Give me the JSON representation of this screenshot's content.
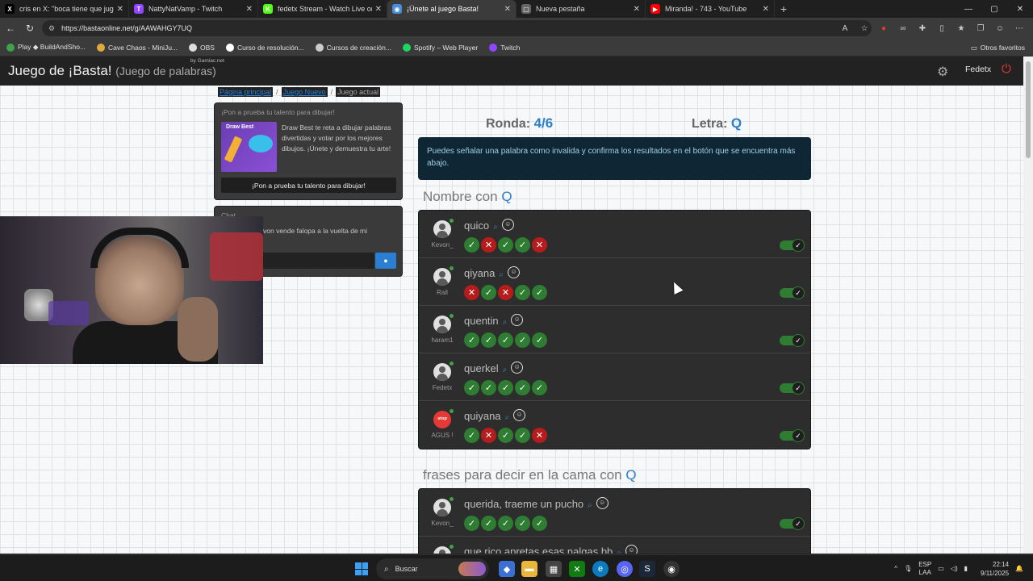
{
  "browser": {
    "tabs": [
      {
        "label": "cris en X: \"boca tiene que jugar lo",
        "icon": "x-logo-icon",
        "color": "#000000",
        "glyph": "X",
        "active": false
      },
      {
        "label": "NattyNatVamp - Twitch",
        "icon": "twitch-icon",
        "color": "#9146ff",
        "glyph": "T",
        "active": false
      },
      {
        "label": "fedetx Stream - Watch Live on Ki",
        "icon": "kick-icon",
        "color": "#53fc18",
        "glyph": "K",
        "active": false
      },
      {
        "label": "¡Únete al juego Basta!",
        "icon": "globe-icon",
        "color": "#4a8fd6",
        "glyph": "◉",
        "active": true
      },
      {
        "label": "Nueva pestaña",
        "icon": "newtab-icon",
        "color": "#666666",
        "glyph": "▢",
        "active": false
      },
      {
        "label": "Miranda! - 743 - YouTube",
        "icon": "youtube-icon",
        "color": "#ff0000",
        "glyph": "▶",
        "active": false
      }
    ],
    "url": "https://bastaonline.net/g/AAWAHGY7UQ",
    "bookmarks": [
      {
        "label": "Play ◆ BuildAndSho...",
        "color": "#3ea34a"
      },
      {
        "label": "Cave Chaos - MiniJu...",
        "color": "#e2a93b"
      },
      {
        "label": "OBS",
        "color": "#dddddd"
      },
      {
        "label": "Curso de resolución...",
        "color": "#ffffff"
      },
      {
        "label": "Cursos de creación...",
        "color": "#cccccc"
      },
      {
        "label": "Spotify – Web Player",
        "color": "#1ed760"
      },
      {
        "label": "Twitch",
        "color": "#9146ff"
      }
    ],
    "other_bookmarks": "Otros favoritos"
  },
  "site": {
    "title": "Juego de ¡Basta!",
    "subtitle": "(Juego de palabras)",
    "by": "by Gamiac.net",
    "user": "Fedetx"
  },
  "breadcrumb": {
    "home": "Página principal",
    "new_game": "Juego Nuevo",
    "current": "Juego actual",
    "sep": "/"
  },
  "promo": {
    "title": "¡Pon a prueba tu talento para dibujar!",
    "logo": "Draw Best",
    "text": "Draw Best te reta a dibujar palabras divertidas y votar por los mejores dibujos. ¡Únete y demuestra tu arte!",
    "button": "¡Pon a prueba tu talento para dibujar!"
  },
  "chat": {
    "title": "Chat",
    "message": "von vende falopa a la vuelta de mi"
  },
  "game": {
    "round_label": "Ronda:",
    "round_value": "4/6",
    "letter_label": "Letra:",
    "letter_value": "Q",
    "info": "Puedes señalar una palabra como invalida y confirma los resultados en el botón que se encuentra más abajo.",
    "categories": [
      {
        "title": "Nombre con",
        "letter": "Q",
        "answers": [
          {
            "word": "quico",
            "player": "Kevon_",
            "avatar": "default",
            "votes": [
              "ok",
              "no",
              "ok",
              "ok",
              "no"
            ],
            "valid": true
          },
          {
            "word": "qiyana",
            "player": "Rall",
            "avatar": "default",
            "votes": [
              "no",
              "ok",
              "no",
              "ok",
              "ok"
            ],
            "valid": true
          },
          {
            "word": "quentin",
            "player": "haram1",
            "avatar": "default",
            "votes": [
              "ok",
              "ok",
              "ok",
              "ok",
              "ok"
            ],
            "valid": true
          },
          {
            "word": "querkel",
            "player": "Fedetx",
            "avatar": "default",
            "votes": [
              "ok",
              "ok",
              "ok",
              "ok",
              "ok"
            ],
            "valid": true
          },
          {
            "word": "quiyana",
            "player": "AGUS !",
            "avatar": "stop",
            "avatar_text": "stop",
            "votes": [
              "ok",
              "no",
              "ok",
              "ok",
              "no"
            ],
            "valid": true
          }
        ]
      },
      {
        "title": "frases para decir en la cama con",
        "letter": "Q",
        "answers": [
          {
            "word": "querida, traeme un pucho",
            "player": "Kevon_",
            "avatar": "default",
            "votes": [
              "ok",
              "ok",
              "ok",
              "ok",
              "ok"
            ],
            "valid": true
          },
          {
            "word": "que rico apretas esas nalgas bb",
            "player": "",
            "avatar": "default",
            "votes": [],
            "valid": true
          }
        ]
      }
    ]
  },
  "taskbar": {
    "search": "Buscar",
    "lang_top": "ESP",
    "lang_bottom": "LAA",
    "time": "22:14",
    "date": "9/11/2025"
  }
}
